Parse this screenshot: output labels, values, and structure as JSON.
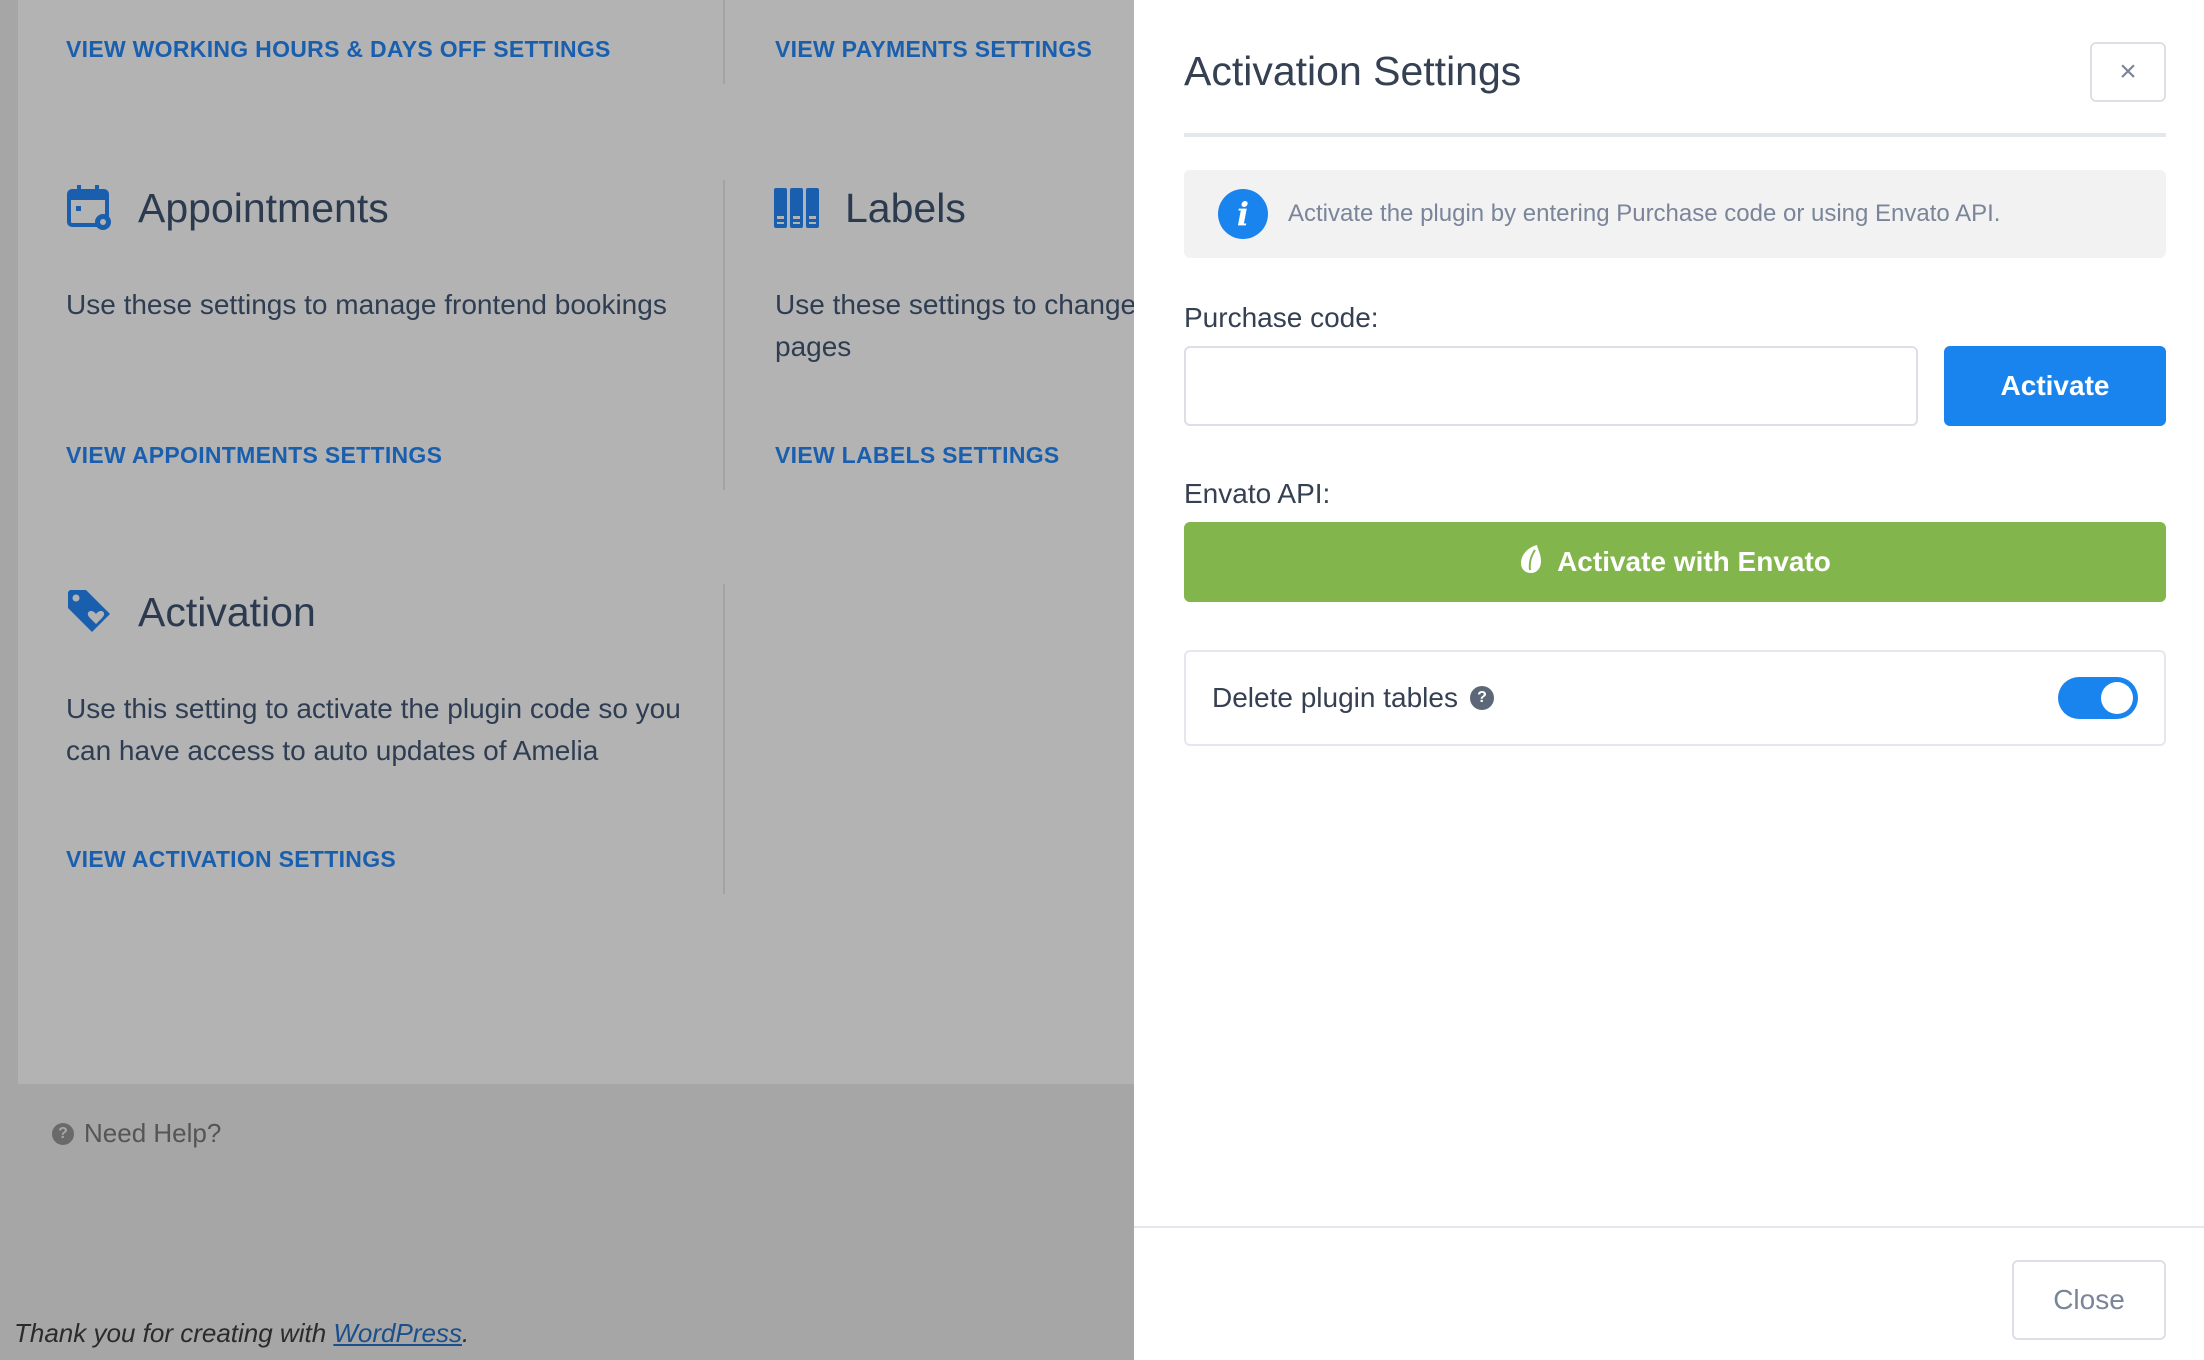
{
  "background": {
    "working_hours_link": "VIEW WORKING HOURS & DAYS OFF SETTINGS",
    "payments_link": "VIEW PAYMENTS SETTINGS",
    "appointments": {
      "title": "Appointments",
      "description": "Use these settings to manage frontend bookings",
      "link": "VIEW APPOINTMENTS SETTINGS"
    },
    "labels": {
      "title": "Labels",
      "description": "Use these settings to change pages",
      "link": "VIEW LABELS SETTINGS"
    },
    "activation": {
      "title": "Activation",
      "description": "Use this setting to activate the plugin code so you can have access to auto updates of Amelia",
      "link": "VIEW ACTIVATION SETTINGS"
    },
    "need_help": "Need Help?",
    "footer_prefix": "Thank you for creating with ",
    "footer_link": "WordPress",
    "footer_suffix": ".",
    "accent_color": "#1a5fae"
  },
  "panel": {
    "title": "Activation Settings",
    "close_x": "×",
    "info_text": "Activate the plugin by entering Purchase code or using Envato API.",
    "purchase_code_label": "Purchase code:",
    "purchase_code_value": "",
    "activate_button": "Activate",
    "envato_api_label": "Envato API:",
    "envato_button": "Activate with Envato",
    "delete_tables_label": "Delete plugin tables",
    "delete_tables_enabled": true,
    "close_button": "Close",
    "colors": {
      "primary": "#1a84ee",
      "envato_green": "#82b54b"
    }
  }
}
